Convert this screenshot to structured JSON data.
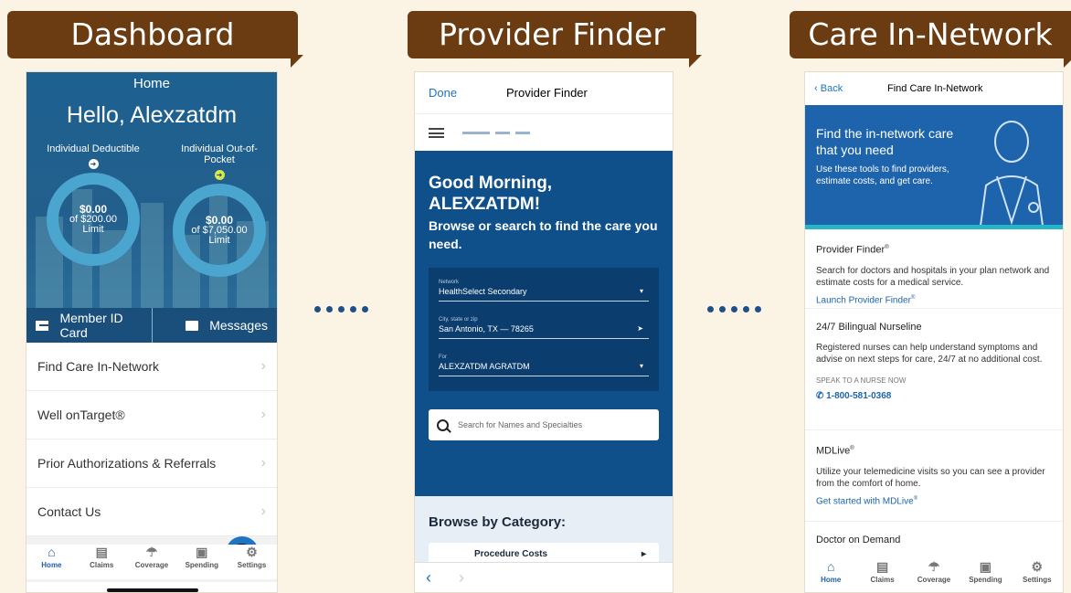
{
  "labels": {
    "dashboard": "Dashboard",
    "provider_finder": "Provider Finder",
    "care_in_network": "Care In-Network"
  },
  "dashboard": {
    "header_title": "Home",
    "greeting": "Hello, Alexzatdm",
    "deductible": {
      "label": "Individual Deductible",
      "amount": "$0.00",
      "limit": "of $200.00 Limit",
      "progress_percent": 0
    },
    "out_of_pocket": {
      "label": "Individual Out-of-Pocket",
      "amount": "$0.00",
      "limit": "of $7,050.00 Limit",
      "progress_percent": 0
    },
    "member_id": "Member ID Card",
    "messages": "Messages",
    "menu": [
      {
        "label": "Find Care In-Network"
      },
      {
        "label": "Well onTarget®"
      },
      {
        "label": "Prior Authorizations & Referrals"
      },
      {
        "label": "Contact Us"
      }
    ],
    "tabs": [
      {
        "label": "Home",
        "icon": "home-icon",
        "active": true
      },
      {
        "label": "Claims",
        "icon": "claims-icon",
        "active": false
      },
      {
        "label": "Coverage",
        "icon": "coverage-icon",
        "active": false
      },
      {
        "label": "Spending",
        "icon": "spending-icon",
        "active": false
      },
      {
        "label": "Settings",
        "icon": "settings-icon",
        "active": false
      }
    ]
  },
  "provider": {
    "done": "Done",
    "title": "Provider Finder",
    "greeting": "Good Morning, ALEXZATDM!",
    "subgreeting": "Browse or search to find the care you need.",
    "network_label": "Network",
    "network_value": "HealthSelect Secondary",
    "city_label": "City, state or zip",
    "city_value": "San Antonio, TX — 78265",
    "for_label": "For",
    "for_value": "ALEXZATDM AGRATDM",
    "search_placeholder": "Search for Names and Specialties",
    "browse_title": "Browse by Category:",
    "category_first": "Procedure Costs"
  },
  "care": {
    "back": "Back",
    "title": "Find Care In-Network",
    "hero_title": "Find the in-network care that you need",
    "hero_desc": "Use these tools to find providers, estimate costs, and get care.",
    "pf_title": "Provider Finder",
    "pf_desc": "Search for doctors and hospitals in your plan network and estimate costs for a medical service.",
    "pf_link": "Launch Provider Finder",
    "nl_title": "24/7 Bilingual Nurseline",
    "nl_desc": "Registered nurses can help understand symptoms and advise on next steps for care, 24/7 at no additional cost.",
    "nl_speak": "SPEAK TO A NURSE NOW",
    "nl_phone": "1-800-581-0368",
    "md_title": "MDLive",
    "md_desc": "Utilize your telemedicine visits so you can see a provider from the comfort of home.",
    "md_link": "Get started with MDLive",
    "dod_title": "Doctor on Demand"
  },
  "colors": {
    "brown_tag": "#6b3c12",
    "navy": "#0f4f8a",
    "accent_blue": "#1e73c2",
    "teal": "#26b5c8"
  }
}
